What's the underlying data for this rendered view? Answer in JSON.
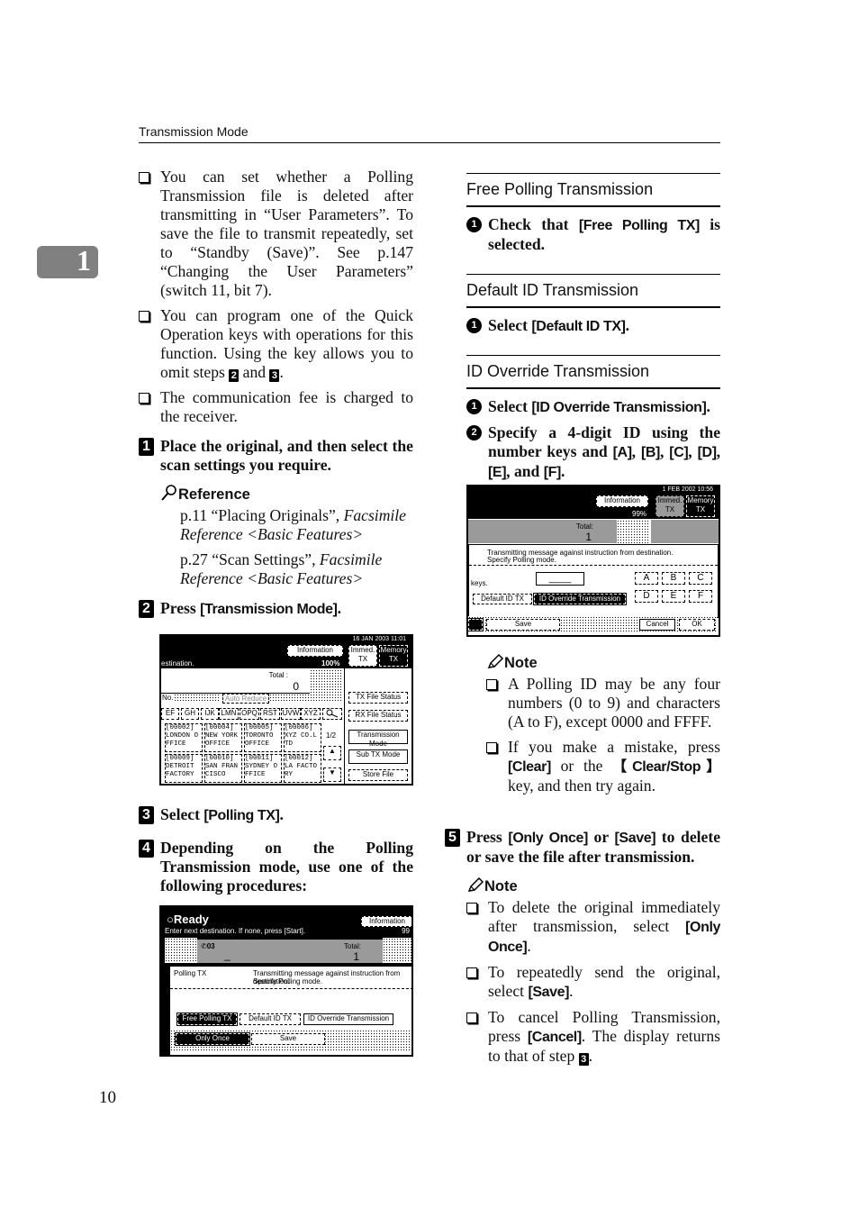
{
  "running_header": "Transmission Mode",
  "chapter_tab": "1",
  "page_number": "10",
  "left_column": {
    "bullets": [
      {
        "text": "You can set whether a Polling Transmission file is deleted after transmitting in “User Parameters”. To save the file to transmit repeatedly, set to “Standby (Save)”. See p.147 “Changing the User Parameters” (switch 11, bit 7)."
      },
      {
        "text_before": "You can program one of the Quick Operation keys with operations for this function. Using the key allows you to omit steps ",
        "step_a": "2",
        "text_mid": " and ",
        "step_b": "3",
        "text_after": "."
      },
      {
        "text": "The communication fee is charged to the receiver."
      }
    ],
    "step1": {
      "num": "1",
      "text": "Place the original, and then select the scan settings you require."
    },
    "reference": {
      "title": "Reference",
      "items": [
        {
          "plain": "p.11 “Placing Originals”, ",
          "italic": "Facsimile Reference <Basic Features>"
        },
        {
          "plain": "p.27 “Scan Settings”, ",
          "italic": "Facsimile Reference <Basic Features>"
        }
      ]
    },
    "step2": {
      "num": "2",
      "prefix": "Press ",
      "key": "[Transmission Mode]",
      "suffix": "."
    },
    "step3": {
      "num": "3",
      "prefix": "Select ",
      "key": "[Polling TX]",
      "suffix": "."
    },
    "step4": {
      "num": "4",
      "text": "Depending on the Polling Transmission mode, use one of the following procedures:"
    }
  },
  "screen1": {
    "datetime": "16 JAN  2003 11:01",
    "status": "estination.",
    "info_btn": "Information",
    "memory_pct": "100%",
    "immed_tx": "Immed. TX",
    "memory_tx": "Memory TX",
    "total_label": "Total :",
    "total_value": "0",
    "no_label": "No.",
    "auto_reduce": "Auto Reduce",
    "tx_file_status": "TX File Status",
    "rx_file_status": "RX File Status",
    "transmission_mode": "Transmission Mode",
    "sub_tx_mode": "Sub TX Mode",
    "store_file": "Store File",
    "page_indicator": "1/2",
    "alpha_tabs": [
      "EF",
      "GH",
      "IJK",
      "LMN",
      "OPQ",
      "RST",
      "UVW",
      "XYZ"
    ],
    "destinations": [
      {
        "code": "[00002]",
        "name": "LONDON O FFICE"
      },
      {
        "code": "[00004]",
        "name": "NEW YORK OFFICE"
      },
      {
        "code": "[00005]",
        "name": "TORONTO OFFICE"
      },
      {
        "code": "[00006]",
        "name": "XYZ CO.L TD"
      },
      {
        "code": "[00009]",
        "name": "DETROIT FACTORY"
      },
      {
        "code": "[00010]",
        "name": "SAN FRAN CISCO"
      },
      {
        "code": "[00011]",
        "name": "SYDNEY O FFICE"
      },
      {
        "code": "[00012]",
        "name": "LA FACTO RY"
      }
    ]
  },
  "screen2": {
    "ready": "Ready",
    "status": "Enter next destination. If none, press [Start].",
    "info_btn": "Information",
    "memory_pct": "99",
    "dest_number": "03",
    "dest_cursor": "_",
    "total_label": "Total:",
    "total_value": "1",
    "panel_title": "Polling TX",
    "panel_msg1": "Transmitting message against instruction from destination.",
    "panel_msg2": "Specify Polling mode.",
    "mode_btns": [
      "Free Polling TX",
      "Default ID TX",
      "ID Override Transmission"
    ],
    "only_once": "Only Once",
    "save": "Save"
  },
  "right_column": {
    "free_polling": {
      "title": "Free Polling Transmission",
      "step": {
        "num": "1",
        "prefix": "Check that ",
        "key": "[Free Polling TX]",
        "suffix": " is selected."
      }
    },
    "default_id": {
      "title": "Default ID Transmission",
      "step": {
        "num": "1",
        "prefix": "Select ",
        "key": "[Default ID TX]",
        "suffix": "."
      }
    },
    "id_override": {
      "title": "ID Override Transmission",
      "step1": {
        "num": "1",
        "prefix": "Select ",
        "key": "[ID Override Transmission]",
        "suffix": "."
      },
      "step2": {
        "num": "2",
        "p1": "Specify a 4-digit ID using the number keys and ",
        "k1": "[A]",
        "c1": ", ",
        "k2": "[B]",
        "c2": ", ",
        "k3": "[C]",
        "c3": ", ",
        "k4": "[D]",
        "c4": ", ",
        "k5": "[E]",
        "c5": ", and ",
        "k6": "[F]",
        "end": "."
      }
    },
    "note1": {
      "title": "Note",
      "b1": "A Polling ID may be any four numbers (0 to 9) and characters (A to F), except 0000 and FFFF.",
      "b2_pre": "If you make a mistake, press ",
      "b2_key1": "[Clear]",
      "b2_mid": " or the ",
      "b2_key2": "【Clear/Stop】",
      "b2_post": " key, and then try again."
    },
    "step5": {
      "num": "5",
      "p1": "Press ",
      "k1": "[Only Once]",
      "p2": " or ",
      "k2": "[Save]",
      "p3": " to delete or save the file after transmission."
    },
    "note2": {
      "title": "Note",
      "b1_pre": "To delete the original immediately after transmission, select ",
      "b1_key": "[Only Once]",
      "b1_post": ".",
      "b2_pre": "To repeatedly send the original, select ",
      "b2_key": "[Save]",
      "b2_post": ".",
      "b3_pre": "To cancel Polling Transmission, press ",
      "b3_key": "[Cancel]",
      "b3_mid": ". The display returns to that of step ",
      "b3_step": "3",
      "b3_post": "."
    }
  },
  "screen3": {
    "datetime": "1 FEB  2002 10:56",
    "info_btn": "Information",
    "memory_pct": "99%",
    "immed_tx": "Immed. TX",
    "memory_tx": "Memory TX",
    "total_label": "Total:",
    "total_value": "1",
    "msg1": "Transmitting message against instruction from destination.",
    "msg2": "Specify Polling mode.",
    "keys_label": "keys.",
    "id_field": "____",
    "hex_keys": [
      "A",
      "B",
      "C",
      "D",
      "E",
      "F"
    ],
    "default_id_tx": "Default ID TX",
    "id_override": "ID Override Transmission",
    "save": "Save",
    "cancel": "Cancel",
    "ok": "OK"
  }
}
